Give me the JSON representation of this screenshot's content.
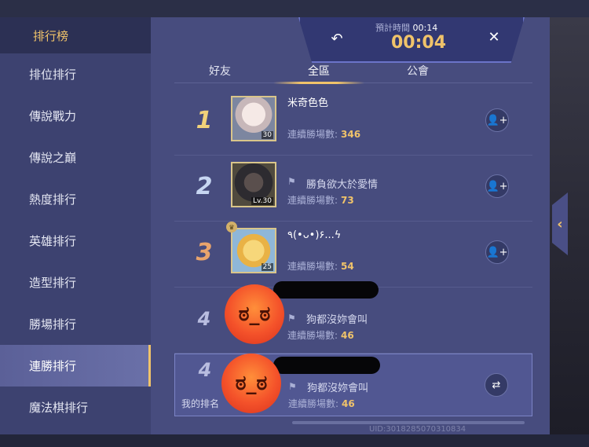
{
  "sidebar": {
    "title": "排行榜",
    "items": [
      {
        "label": "排位排行"
      },
      {
        "label": "傳說戰力"
      },
      {
        "label": "傳說之巔"
      },
      {
        "label": "熱度排行"
      },
      {
        "label": "英雄排行"
      },
      {
        "label": "造型排行"
      },
      {
        "label": "勝場排行"
      },
      {
        "label": "連勝排行",
        "active": true
      },
      {
        "label": "魔法棋排行"
      }
    ]
  },
  "tabs": [
    {
      "label": "好友"
    },
    {
      "label": "全區",
      "selected": true
    },
    {
      "label": "公會"
    }
  ],
  "timer": {
    "label": "預計時間",
    "label_time": "00:14",
    "value": "00:04"
  },
  "rows": [
    {
      "rank": "1",
      "name": "米奇色色",
      "level": "30",
      "stat_label": "連續勝場數:",
      "stat_value": "346"
    },
    {
      "rank": "2",
      "name": "勝負欲大於愛情",
      "level": "Lv.30",
      "stat_label": "連續勝場數:",
      "stat_value": "73"
    },
    {
      "rank": "3",
      "name": "٩(•ᴗ•)۶...ϟ",
      "level": "25",
      "stat_label": "連續勝場數:",
      "stat_value": "54"
    },
    {
      "rank": "4",
      "name": "狗都沒妳會叫",
      "stat_label": "連續勝場數:",
      "stat_value": "46"
    }
  ],
  "my_row": {
    "rank": "4",
    "name": "狗都沒妳會叫",
    "my_label": "我的排名",
    "stat_label": "連續勝場數:",
    "stat_value": "46"
  },
  "footer": {
    "uid": "UID:3018285070310834"
  },
  "colors": {
    "accent": "#f0c36a",
    "sidebar_bg": "#3d4270",
    "panel_bg": "#474c7e"
  },
  "icons": {
    "back": "back-arrow-icon",
    "close": "close-icon",
    "add_friend": "add-friend-icon",
    "share": "share-icon",
    "flag": "flag-icon"
  }
}
